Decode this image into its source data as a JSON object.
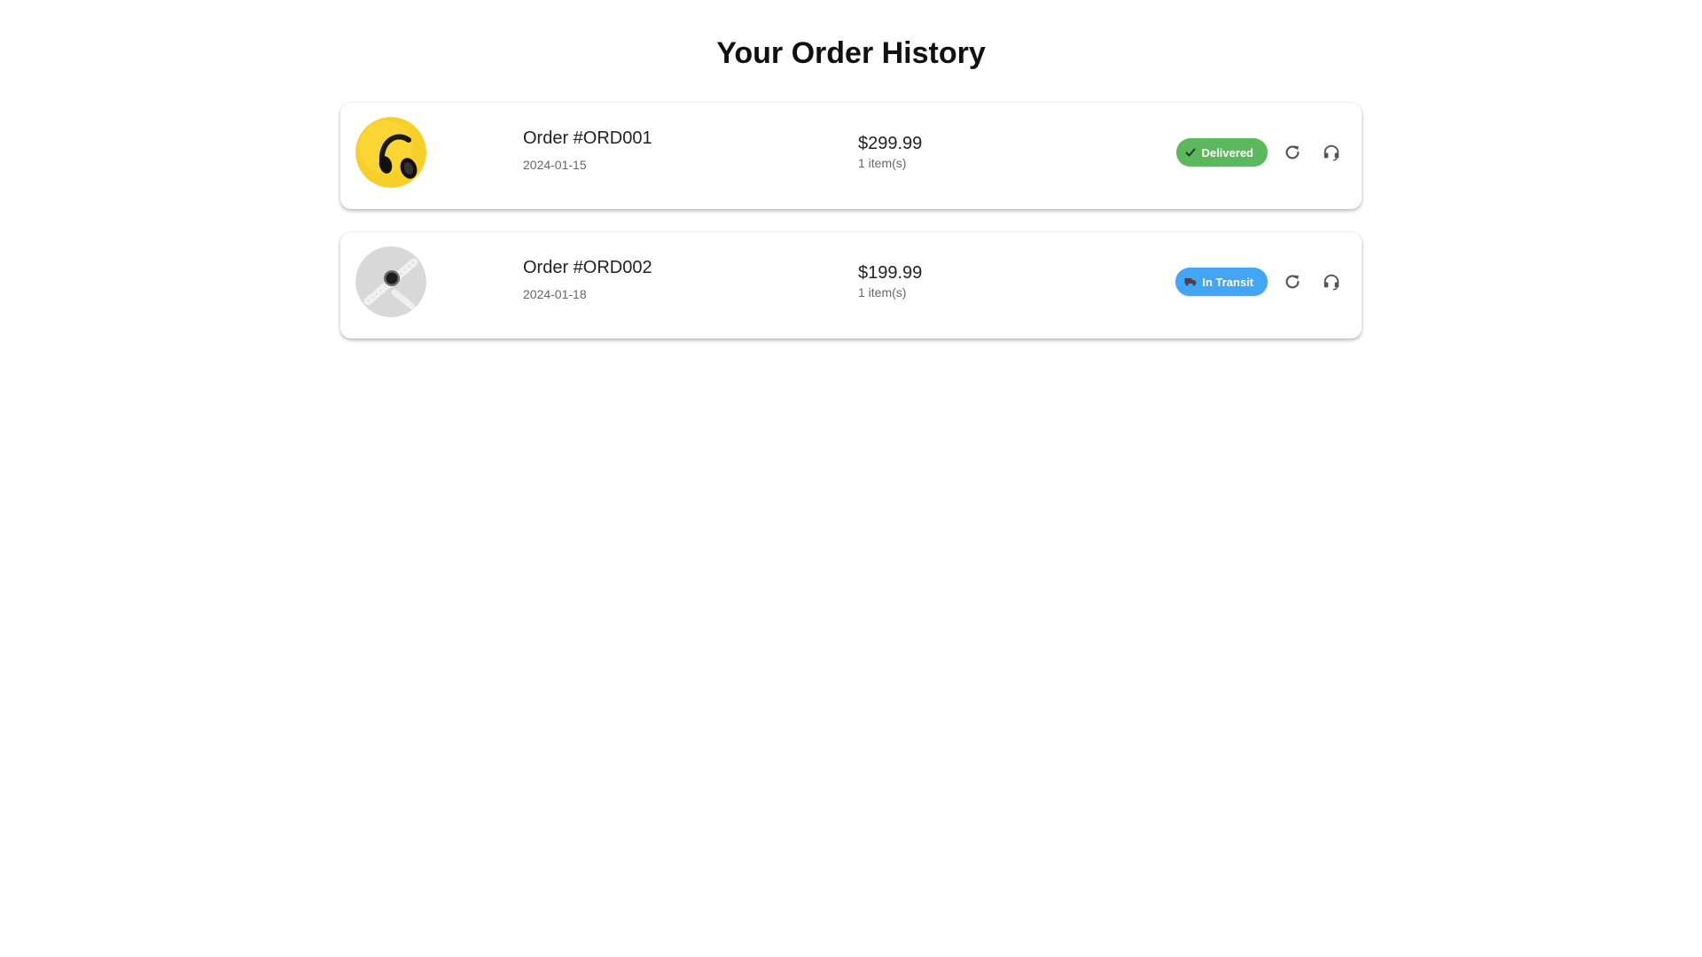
{
  "page": {
    "title": "Your Order History"
  },
  "colors": {
    "delivered": "#5cb85c",
    "in_transit": "#42a5f5",
    "icon_gray": "#555555"
  },
  "orders": [
    {
      "id_label": "Order #ORD001",
      "date": "2024-01-15",
      "price": "$299.99",
      "items": "1 item(s)",
      "status": "Delivered",
      "status_icon": "check-icon",
      "thumbnail": "headphones-image"
    },
    {
      "id_label": "Order #ORD002",
      "date": "2024-01-18",
      "price": "$199.99",
      "items": "1 item(s)",
      "status": "In Transit",
      "status_icon": "truck-icon",
      "thumbnail": "smartwatch-image"
    }
  ],
  "actions": {
    "reorder_icon": "refresh-icon",
    "support_icon": "headset-icon"
  }
}
